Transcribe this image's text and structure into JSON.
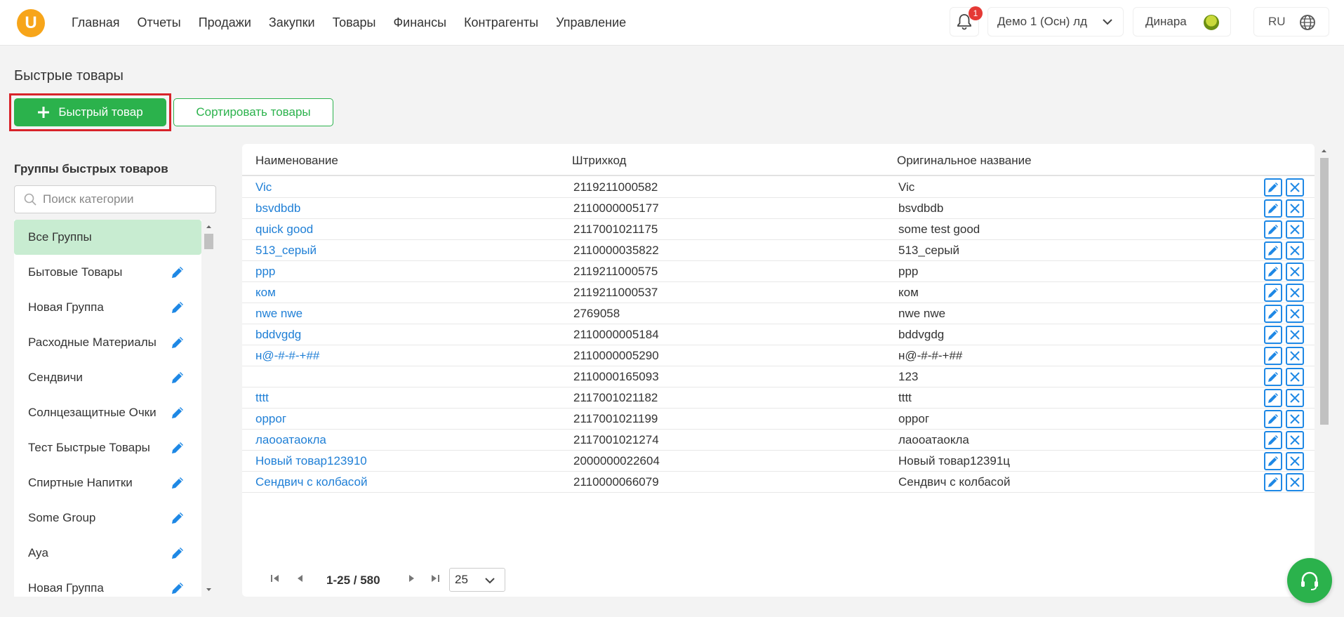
{
  "header": {
    "logo_letter": "U",
    "nav": [
      "Главная",
      "Отчеты",
      "Продажи",
      "Закупки",
      "Товары",
      "Финансы",
      "Контрагенты",
      "Управление"
    ],
    "notifications_count": "1",
    "store": "Демо 1 (Осн) лд",
    "user": "Динара",
    "lang": "RU"
  },
  "page": {
    "title": "Быстрые товары",
    "add_button": "Быстрый товар",
    "sort_button": "Сортировать товары"
  },
  "sidebar": {
    "title": "Группы быстрых товаров",
    "search_placeholder": "Поиск категории",
    "groups": [
      "Все Группы",
      "Бытовые Товары",
      "Новая Группа",
      "Расходные Материалы",
      "Сендвичи",
      "Солнцезащитные Очки",
      "Тест Быстрые Товары",
      "Спиртные Напитки",
      "Some Group",
      "Aya",
      "Новая Группа"
    ]
  },
  "table": {
    "columns": [
      "Наименование",
      "Штрихкод",
      "Оригинальное название"
    ],
    "rows": [
      [
        "Vic",
        "2119211000582",
        "Vic"
      ],
      [
        "bsvdbdb",
        "2110000005177",
        "bsvdbdb"
      ],
      [
        "quick good",
        "2117001021175",
        "some test good"
      ],
      [
        "513_серый",
        "2110000035822",
        "513_серый"
      ],
      [
        "ppp",
        "2119211000575",
        "ppp"
      ],
      [
        "ком",
        "2119211000537",
        "ком"
      ],
      [
        "nwe nwe",
        "2769058",
        "nwe nwe"
      ],
      [
        "bddvgdg",
        "2110000005184",
        "bddvgdg"
      ],
      [
        "н@-#-#-+##",
        "2110000005290",
        "н@-#-#-+##"
      ],
      [
        "",
        "2110000165093",
        "123"
      ],
      [
        "tttt",
        "2117001021182",
        "tttt"
      ],
      [
        "оррог",
        "2117001021199",
        "оррог"
      ],
      [
        "лаооатаокла",
        "2117001021274",
        "лаооатаокла"
      ],
      [
        "Новый товар123910",
        "2000000022604",
        "Новый товар12391ц"
      ],
      [
        "Сендвич с колбасой",
        "2110000066079",
        "Сендвич с колбасой"
      ]
    ]
  },
  "pager": {
    "range": "1-25 / 580",
    "page_size": "25"
  },
  "colors": {
    "accent_green": "#2bb24c",
    "link_blue": "#1f7fd6",
    "icon_blue": "#1e88e5",
    "highlight_red": "#d8232a",
    "logo_orange": "#f7a51a"
  }
}
